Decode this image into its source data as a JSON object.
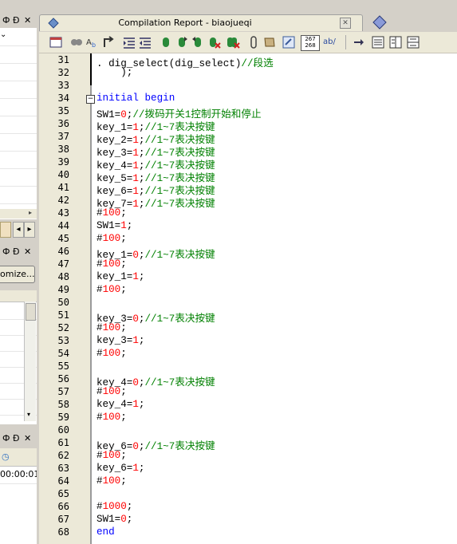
{
  "left_panes": {
    "pane1_controls": [
      "Ф",
      "Ð",
      "✕"
    ],
    "pane2_controls": [
      "Ф",
      "Ð",
      "✕"
    ],
    "pane2_button": "omize...",
    "pane3_controls": [
      "Ф",
      "Ð",
      "✕"
    ],
    "pane3_time": "00:00:01"
  },
  "editor": {
    "tab_title": "Compilation Report - biaojueqi",
    "font_size_badge_top": "267",
    "font_size_badge_bottom": "268",
    "ab_label": "ab/"
  },
  "code_lines": [
    {
      "n": "31",
      "parts": [
        [
          ". dig_select(dig_select)",
          ""
        ],
        [
          "//段选",
          "cm"
        ]
      ]
    },
    {
      "n": "32",
      "parts": [
        [
          "    );",
          ""
        ]
      ]
    },
    {
      "n": "33",
      "parts": []
    },
    {
      "n": "34",
      "parts": [
        [
          "initial begin",
          "kw"
        ]
      ],
      "fold": "−"
    },
    {
      "n": "35",
      "parts": [
        [
          "SW1=",
          ""
        ],
        [
          "0",
          "num"
        ],
        [
          ";",
          ""
        ],
        [
          "//拨码开关1控制开始和停止",
          "cm"
        ]
      ]
    },
    {
      "n": "36",
      "parts": [
        [
          "key_1=",
          ""
        ],
        [
          "1",
          "num"
        ],
        [
          ";",
          ""
        ],
        [
          "//1~7表决按键",
          "cm"
        ]
      ]
    },
    {
      "n": "37",
      "parts": [
        [
          "key_2=",
          ""
        ],
        [
          "1",
          "num"
        ],
        [
          ";",
          ""
        ],
        [
          "//1~7表决按键",
          "cm"
        ]
      ]
    },
    {
      "n": "38",
      "parts": [
        [
          "key_3=",
          ""
        ],
        [
          "1",
          "num"
        ],
        [
          ";",
          ""
        ],
        [
          "//1~7表决按键",
          "cm"
        ]
      ]
    },
    {
      "n": "39",
      "parts": [
        [
          "key_4=",
          ""
        ],
        [
          "1",
          "num"
        ],
        [
          ";",
          ""
        ],
        [
          "//1~7表决按键",
          "cm"
        ]
      ]
    },
    {
      "n": "40",
      "parts": [
        [
          "key_5=",
          ""
        ],
        [
          "1",
          "num"
        ],
        [
          ";",
          ""
        ],
        [
          "//1~7表决按键",
          "cm"
        ]
      ]
    },
    {
      "n": "41",
      "parts": [
        [
          "key_6=",
          ""
        ],
        [
          "1",
          "num"
        ],
        [
          ";",
          ""
        ],
        [
          "//1~7表决按键",
          "cm"
        ]
      ]
    },
    {
      "n": "42",
      "parts": [
        [
          "key_7=",
          ""
        ],
        [
          "1",
          "num"
        ],
        [
          ";",
          ""
        ],
        [
          "//1~7表决按键",
          "cm"
        ]
      ]
    },
    {
      "n": "43",
      "parts": [
        [
          "#",
          ""
        ],
        [
          "100",
          "num"
        ],
        [
          ";",
          ""
        ]
      ]
    },
    {
      "n": "44",
      "parts": [
        [
          "SW1=",
          ""
        ],
        [
          "1",
          "num"
        ],
        [
          ";",
          ""
        ]
      ]
    },
    {
      "n": "45",
      "parts": [
        [
          "#",
          ""
        ],
        [
          "100",
          "num"
        ],
        [
          ";",
          ""
        ]
      ]
    },
    {
      "n": "46",
      "parts": [
        [
          "key_1=",
          ""
        ],
        [
          "0",
          "num"
        ],
        [
          ";",
          ""
        ],
        [
          "//1~7表决按键",
          "cm"
        ]
      ]
    },
    {
      "n": "47",
      "parts": [
        [
          "#",
          ""
        ],
        [
          "100",
          "num"
        ],
        [
          ";",
          ""
        ]
      ]
    },
    {
      "n": "48",
      "parts": [
        [
          "key_1=",
          ""
        ],
        [
          "1",
          "num"
        ],
        [
          ";",
          ""
        ]
      ]
    },
    {
      "n": "49",
      "parts": [
        [
          "#",
          ""
        ],
        [
          "100",
          "num"
        ],
        [
          ";",
          ""
        ]
      ]
    },
    {
      "n": "50",
      "parts": []
    },
    {
      "n": "51",
      "parts": [
        [
          "key_3=",
          ""
        ],
        [
          "0",
          "num"
        ],
        [
          ";",
          ""
        ],
        [
          "//1~7表决按键",
          "cm"
        ]
      ]
    },
    {
      "n": "52",
      "parts": [
        [
          "#",
          ""
        ],
        [
          "100",
          "num"
        ],
        [
          ";",
          ""
        ]
      ]
    },
    {
      "n": "53",
      "parts": [
        [
          "key_3=",
          ""
        ],
        [
          "1",
          "num"
        ],
        [
          ";",
          ""
        ]
      ]
    },
    {
      "n": "54",
      "parts": [
        [
          "#",
          ""
        ],
        [
          "100",
          "num"
        ],
        [
          ";",
          ""
        ]
      ]
    },
    {
      "n": "55",
      "parts": []
    },
    {
      "n": "56",
      "parts": [
        [
          "key_4=",
          ""
        ],
        [
          "0",
          "num"
        ],
        [
          ";",
          ""
        ],
        [
          "//1~7表决按键",
          "cm"
        ]
      ]
    },
    {
      "n": "57",
      "parts": [
        [
          "#",
          ""
        ],
        [
          "100",
          "num"
        ],
        [
          ";",
          ""
        ]
      ]
    },
    {
      "n": "58",
      "parts": [
        [
          "key_4=",
          ""
        ],
        [
          "1",
          "num"
        ],
        [
          ";",
          ""
        ]
      ]
    },
    {
      "n": "59",
      "parts": [
        [
          "#",
          ""
        ],
        [
          "100",
          "num"
        ],
        [
          ";",
          ""
        ]
      ]
    },
    {
      "n": "60",
      "parts": []
    },
    {
      "n": "61",
      "parts": [
        [
          "key_6=",
          ""
        ],
        [
          "0",
          "num"
        ],
        [
          ";",
          ""
        ],
        [
          "//1~7表决按键",
          "cm"
        ]
      ]
    },
    {
      "n": "62",
      "parts": [
        [
          "#",
          ""
        ],
        [
          "100",
          "num"
        ],
        [
          ";",
          ""
        ]
      ]
    },
    {
      "n": "63",
      "parts": [
        [
          "key_6=",
          ""
        ],
        [
          "1",
          "num"
        ],
        [
          ";",
          ""
        ]
      ]
    },
    {
      "n": "64",
      "parts": [
        [
          "#",
          ""
        ],
        [
          "100",
          "num"
        ],
        [
          ";",
          ""
        ]
      ]
    },
    {
      "n": "65",
      "parts": []
    },
    {
      "n": "66",
      "parts": [
        [
          "#",
          ""
        ],
        [
          "1000",
          "num"
        ],
        [
          ";",
          ""
        ]
      ]
    },
    {
      "n": "67",
      "parts": [
        [
          "SW1=",
          ""
        ],
        [
          "0",
          "num"
        ],
        [
          ";",
          ""
        ]
      ]
    },
    {
      "n": "68",
      "parts": [
        [
          "end",
          "kw"
        ]
      ]
    }
  ]
}
